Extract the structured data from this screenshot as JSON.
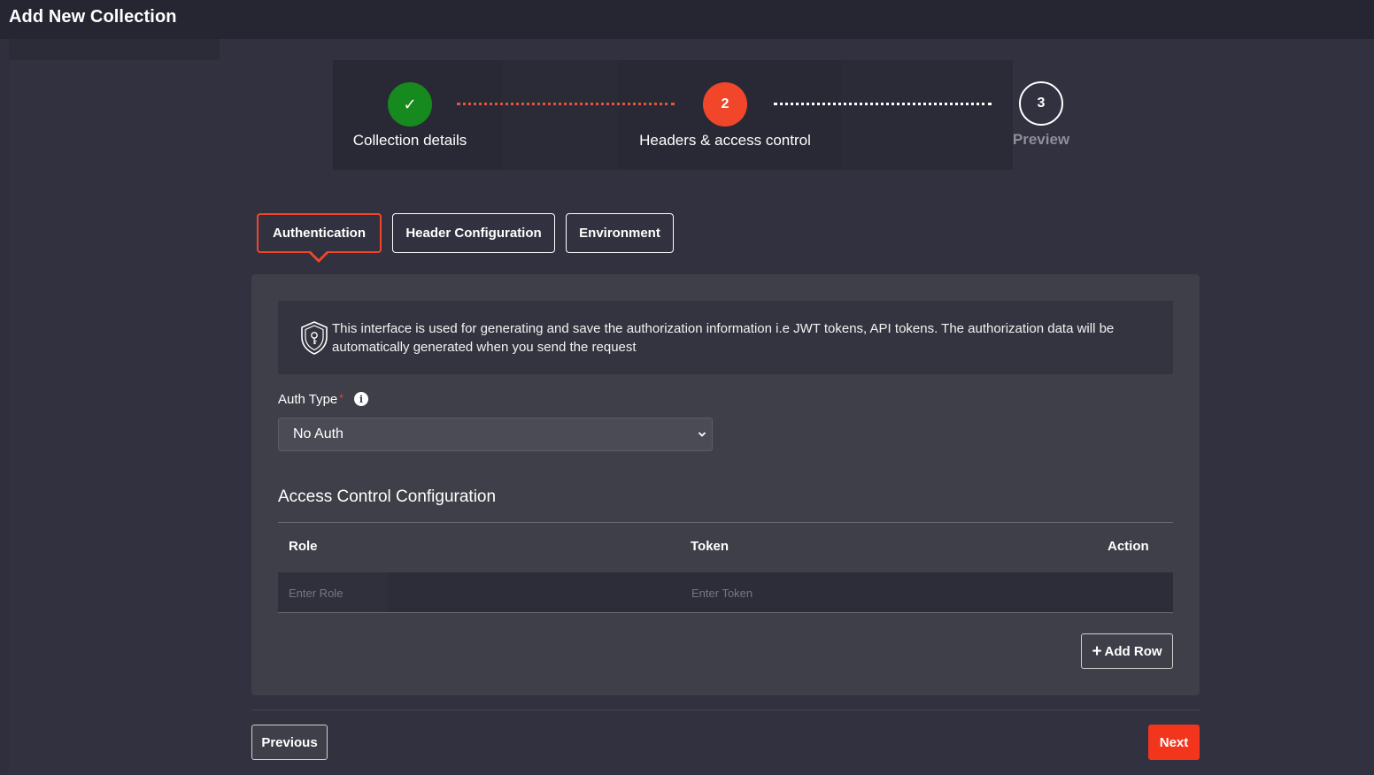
{
  "header": {
    "title": "Add New Collection"
  },
  "stepper": {
    "steps": [
      {
        "number": "✓",
        "label": "Collection details",
        "state": "completed",
        "color": "#178a1f"
      },
      {
        "number": "2",
        "label": "Headers & access control",
        "state": "active",
        "color": "#f2462a"
      },
      {
        "number": "3",
        "label": "Preview",
        "state": "pending"
      }
    ]
  },
  "tabs": [
    {
      "label": "Authentication",
      "active": true
    },
    {
      "label": "Header Configuration",
      "active": false
    },
    {
      "label": "Environment",
      "active": false
    }
  ],
  "info": {
    "icon": "shield-icon",
    "text": "This interface is used for generating and save the authorization information i.e JWT tokens, API tokens. The authorization data will be automatically generated when you send the request"
  },
  "auth": {
    "label": "Auth Type",
    "required_mark": "*",
    "info_icon": "i",
    "selected": "No Auth"
  },
  "access_control": {
    "title": "Access Control Configuration",
    "columns": {
      "role": "Role",
      "token": "Token",
      "action": "Action"
    },
    "row": {
      "role_placeholder": "Enter Role",
      "token_placeholder": "Enter Token"
    },
    "add_row_label": "Add Row"
  },
  "footer": {
    "previous_label": "Previous",
    "next_label": "Next"
  },
  "colors": {
    "accent": "#f2462a",
    "success": "#178a1f",
    "background": "#2f2f3d",
    "panel": "#3f3f49"
  }
}
